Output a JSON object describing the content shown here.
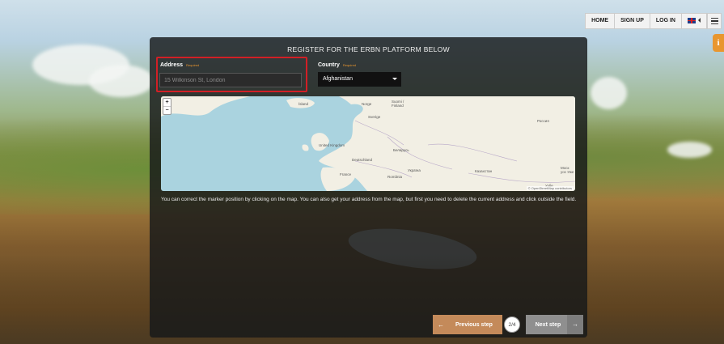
{
  "nav": {
    "items": [
      "HOME",
      "SIGN UP",
      "LOG IN"
    ],
    "language_icon": "uk-flag-icon",
    "menu_icon": "hamburger-icon"
  },
  "info_badge": {
    "icon": "info-icon"
  },
  "form": {
    "title": "REGISTER FOR THE ERBN PLATFORM BELOW",
    "address": {
      "label": "Address",
      "required_label": "Required",
      "placeholder": "15 Wilkinson St, London",
      "value": ""
    },
    "country": {
      "label": "Country",
      "required_label": "Required",
      "selected": "Afghanistan"
    },
    "map": {
      "zoom_in": "+",
      "zoom_out": "−",
      "labels": [
        "Ísland",
        "Norge",
        "Suomi / Finland",
        "Sverige",
        "Россия",
        "United Kingdom",
        "Беларусь",
        "Deutschland",
        "France",
        "România",
        "Україна",
        "Казахстан",
        "Моск уос Уже",
        "Узбе"
      ],
      "attribution": "© OpenStreetMap contributors"
    },
    "hint": "You can correct the marker position by clicking on the map. You can also get your address from the map, but first you need to delete the current address and click outside the field."
  },
  "stepper": {
    "previous_label": "Previous step",
    "next_label": "Next step",
    "step": "2/4"
  },
  "colors": {
    "highlight_border": "#d21f26",
    "accent": "#e8962f",
    "previous_button": "#c48a5a",
    "next_button": "#8f8f8f"
  }
}
